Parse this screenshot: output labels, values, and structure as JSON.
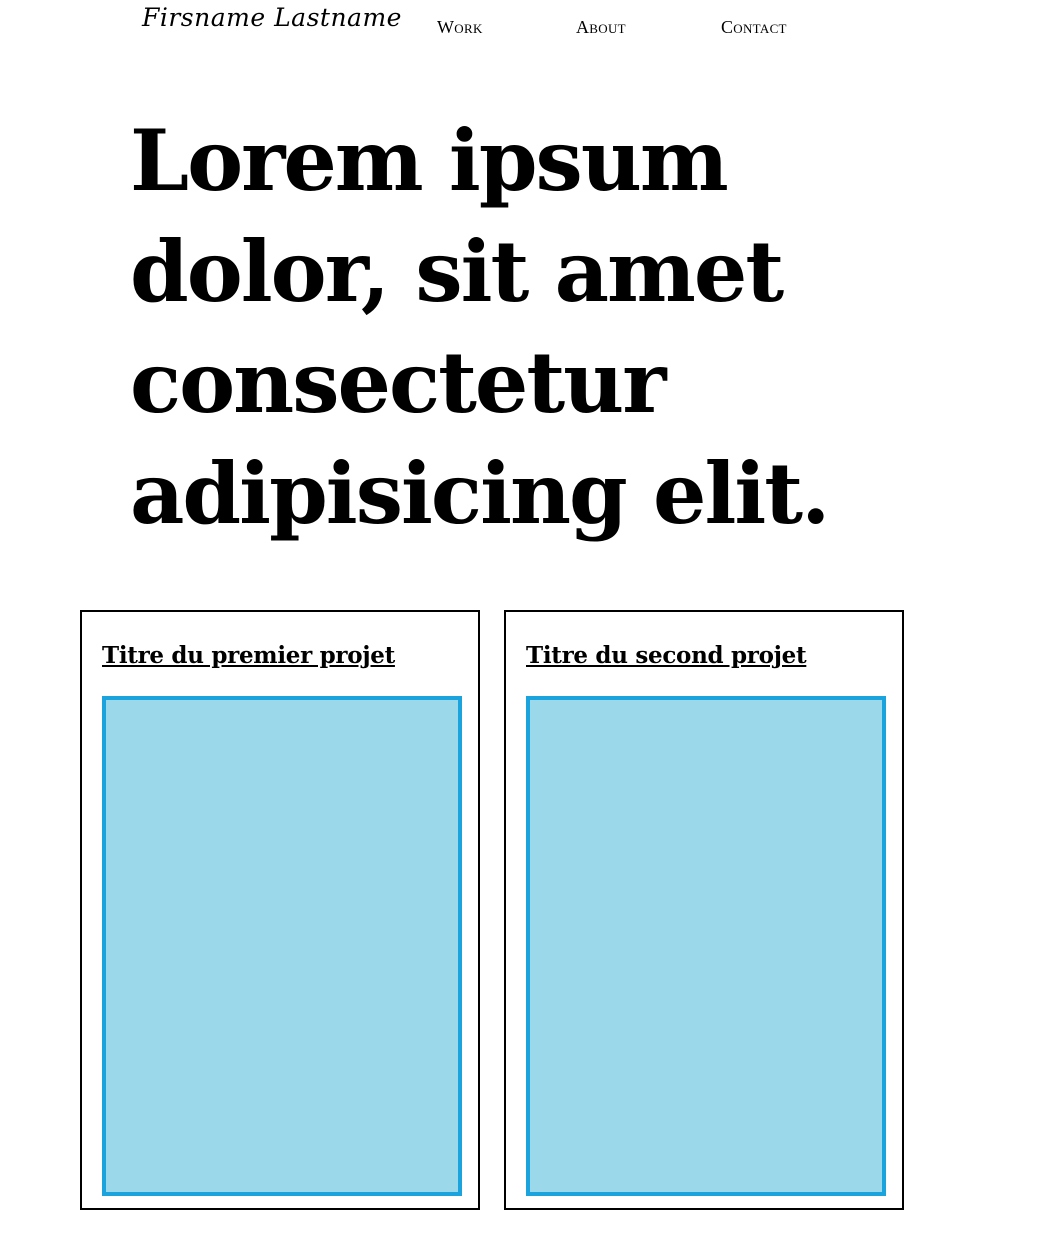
{
  "header": {
    "brand": "Firsname Lastname",
    "nav": [
      {
        "label": "Work"
      },
      {
        "label": "About"
      },
      {
        "label": "Contact"
      }
    ]
  },
  "hero": {
    "heading": "Lorem ipsum dolor, sit amet consectetur adipisicing elit."
  },
  "projects": [
    {
      "title": "Titre du premier projet"
    },
    {
      "title": "Titre du second projet"
    }
  ],
  "colors": {
    "placeholder_fill": "#9ad8ea",
    "placeholder_border": "#1aa3dd"
  }
}
